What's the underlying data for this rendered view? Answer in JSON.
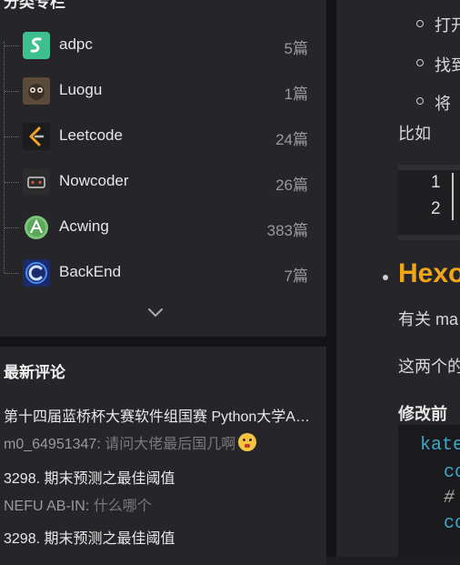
{
  "sidebar": {
    "categories": {
      "title": "分类专栏",
      "items": [
        {
          "name": "adpc",
          "count": "5篇"
        },
        {
          "name": "Luogu",
          "count": "1篇"
        },
        {
          "name": "Leetcode",
          "count": "24篇"
        },
        {
          "name": "Nowcoder",
          "count": "26篇"
        },
        {
          "name": "Acwing",
          "count": "383篇"
        },
        {
          "name": "BackEnd",
          "count": "7篇"
        }
      ]
    },
    "comments": {
      "title": "最新评论",
      "items": [
        {
          "article": "第十四届蓝桥杯大赛软件组国赛 Python大学A组 个人暴力题解",
          "user": "m0_64951347:",
          "text": "请问大佬最后国几啊"
        },
        {
          "article": "3298. 期末预测之最佳阈值",
          "user": "NEFU AB-IN:",
          "text": "什么哪个"
        },
        {
          "article": "3298. 期末预测之最佳阈值",
          "user": "",
          "text": ""
        }
      ]
    }
  },
  "article": {
    "list_items": [
      "打开",
      "找到",
      "将"
    ],
    "para1": "比如",
    "code1_lines": [
      "1",
      "2"
    ],
    "heading": "Hexo",
    "para2": "有关 ma",
    "para3": "这两个的",
    "before_label": "修改前",
    "code2_lines": [
      "kate",
      "co",
      "#",
      "co"
    ]
  }
}
